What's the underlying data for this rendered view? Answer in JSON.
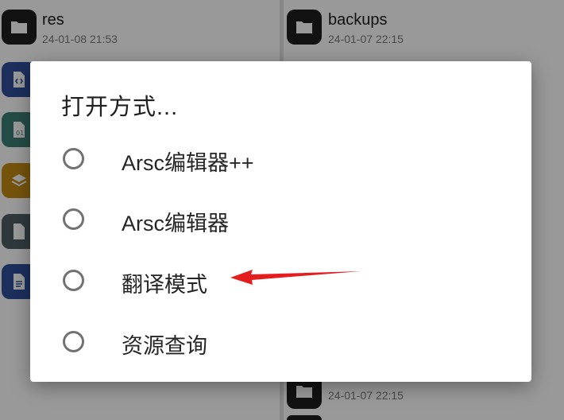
{
  "background_files": {
    "left": [
      {
        "name": "res",
        "date": "24-01-08 21:53",
        "icon": "folder-icon",
        "color": "#1f1f1f"
      },
      {
        "icon": "code-file-icon",
        "color": "#2f4f9c"
      },
      {
        "icon": "binary-file-icon",
        "color": "#3d7f75"
      },
      {
        "icon": "layers-icon",
        "color": "#c48a15"
      },
      {
        "icon": "file-icon",
        "color": "#4f6065"
      },
      {
        "icon": "document-icon",
        "color": "#2f4f9c"
      }
    ],
    "right": [
      {
        "name": "backups",
        "date": "24-01-07 22:15",
        "icon": "folder-icon",
        "color": "#1f1f1f"
      },
      {
        "name": "",
        "date": "24-01-07 22:15",
        "icon": "folder-icon",
        "color": "#1f1f1f"
      }
    ]
  },
  "dialog": {
    "title": "打开方式...",
    "options": [
      {
        "label": "Arsc编辑器++",
        "selected": false
      },
      {
        "label": "Arsc编辑器",
        "selected": false
      },
      {
        "label": "翻译模式",
        "selected": false
      },
      {
        "label": "资源查询",
        "selected": false
      }
    ]
  },
  "annotation": {
    "type": "arrow",
    "color": "#e41e1e",
    "points_to": "翻译模式"
  }
}
